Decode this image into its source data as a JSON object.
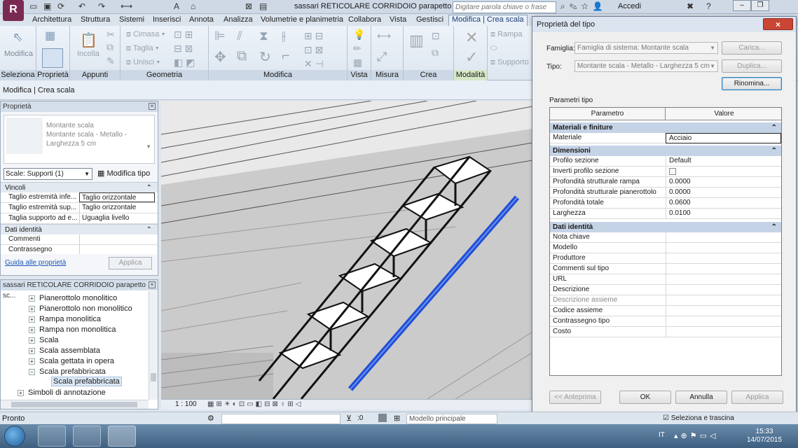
{
  "app": {
    "document_title": "sassari RETICOLARE CORRIDOIO parapetto scal...",
    "search_placeholder": "Digitare parola chiave o frase",
    "sign_in": "Accedi"
  },
  "ribbon_tabs": [
    "Architettura",
    "Struttura",
    "Sistemi",
    "Inserisci",
    "Annota",
    "Analizza",
    "Volumetrie e planimetria",
    "Collabora",
    "Vista",
    "Gestisci",
    "Modifica | Crea scala"
  ],
  "ribbon": {
    "panels": [
      "Seleziona",
      "Proprietà",
      "Appunti",
      "Geometria",
      "Modifica",
      "Vista",
      "Misura",
      "Crea",
      "Modalità"
    ],
    "modify_label": "Modifica",
    "paste_label": "Incolla",
    "cope_label": "Cimasa",
    "cut_label": "Taglia",
    "join_label": "Unisci",
    "ramp_label": "Rampa",
    "support_label": "Supporto"
  },
  "context_bar": "Modifica | Crea scala",
  "properties": {
    "header": "Proprietà",
    "type_family": "Montante scala",
    "type_name": "Montante scala - Metallo - Larghezza 5 cm",
    "filter": "Scale: Supporti (1)",
    "edit_type": "Modifica tipo",
    "groups": [
      {
        "name": "Vincoli",
        "rows": [
          {
            "name": "Taglio estremità infe...",
            "value": "Taglio orizzontale"
          },
          {
            "name": "Taglio estremità sup...",
            "value": "Taglio orizzontale"
          },
          {
            "name": "Taglia supporto ad e...",
            "value": "Uguaglia livello"
          }
        ]
      },
      {
        "name": "Dati identità",
        "rows": [
          {
            "name": "Commenti",
            "value": ""
          },
          {
            "name": "Contrassegno",
            "value": ""
          }
        ]
      }
    ],
    "help_link": "Guida alle proprietà",
    "apply": "Applica"
  },
  "browser": {
    "header": "sassari RETICOLARE CORRIDOIO parapetto sc...",
    "items": [
      "Pianerottolo monolitico",
      "Pianerottolo non monolitico",
      "Rampa monolitica",
      "Rampa non monolitica",
      "Scala",
      "Scala assemblata",
      "Scala gettata in opera",
      "Scala prefabbricata",
      "Scala prefabbricata",
      "Simboli di annotazione"
    ]
  },
  "view": {
    "scale": "1 : 100"
  },
  "dialog": {
    "title": "Proprietà del tipo",
    "family_label": "Famiglia:",
    "family_value": "Famiglia di sistema: Montante scala",
    "type_label": "Tipo:",
    "type_value": "Montante scala - Metallo - Larghezza 5 cm",
    "load_btn": "Carica...",
    "duplicate_btn": "Duplica...",
    "rename_btn": "Rinomina...",
    "params_label": "Parametri tipo",
    "col_param": "Parametro",
    "col_value": "Valore",
    "groups": [
      {
        "name": "Materiali e finiture",
        "rows": [
          {
            "name": "Materiale",
            "value": "Acciaio"
          }
        ]
      },
      {
        "name": "Dimensioni",
        "rows": [
          {
            "name": "Profilo sezione",
            "value": "Default"
          },
          {
            "name": "Inverti profilo sezione",
            "value": ""
          },
          {
            "name": "Profondità strutturale rampa",
            "value": "0.0000"
          },
          {
            "name": "Profondità strutturale pianerottolo",
            "value": "0.0000"
          },
          {
            "name": "Profondità totale",
            "value": "0.0600"
          },
          {
            "name": "Larghezza",
            "value": "0.0100"
          }
        ]
      },
      {
        "name": "Dati identità",
        "rows": [
          {
            "name": "Nota chiave",
            "value": ""
          },
          {
            "name": "Modello",
            "value": ""
          },
          {
            "name": "Produttore",
            "value": ""
          },
          {
            "name": "Commenti sul tipo",
            "value": ""
          },
          {
            "name": "URL",
            "value": ""
          },
          {
            "name": "Descrizione",
            "value": ""
          },
          {
            "name": "Descrizione assieme",
            "value": ""
          },
          {
            "name": "Codice assieme",
            "value": ""
          },
          {
            "name": "Contrassegno tipo",
            "value": ""
          },
          {
            "name": "Costo",
            "value": ""
          }
        ]
      }
    ],
    "preview_btn": "<< Anteprima",
    "ok_btn": "OK",
    "cancel_btn": "Annulla",
    "apply_btn": "Applica"
  },
  "status": {
    "text": "Pronto",
    "zero": ":0",
    "model": "Modello principale",
    "drag": "Seleziona e trascina"
  },
  "taskbar": {
    "lang": "IT",
    "time": "15:33",
    "date": "14/07/2015"
  },
  "colors": {
    "accent": "#1d3f74",
    "support_blue": "#1f4fd6",
    "close_red": "#c94634"
  }
}
